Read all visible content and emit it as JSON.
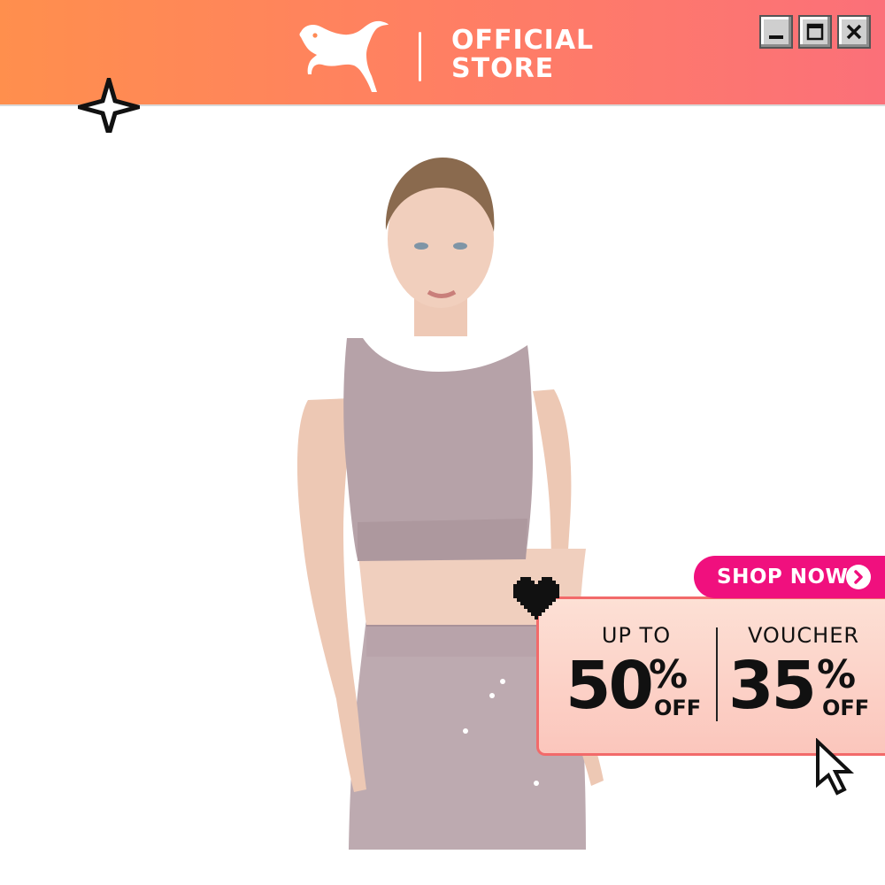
{
  "header": {
    "logo_icon": "puma-cat-logo",
    "store_line1": "OFFICIAL",
    "store_line2": "STORE",
    "colors": {
      "gradient_start": "#ff8f4d",
      "gradient_end": "#fb7079"
    }
  },
  "window_controls": {
    "minimize_icon": "minimize-icon",
    "maximize_icon": "maximize-icon",
    "close_icon": "close-icon"
  },
  "decorations": {
    "sparkle_icon": "sparkle-icon",
    "heart_icon": "pixel-heart-icon",
    "cursor_icon": "pointer-cursor-icon"
  },
  "promo": {
    "cta_label": "SHOP NOW",
    "cta_icon": "chevron-right-circle-icon",
    "left": {
      "top_text": "UP TO",
      "value": "50",
      "percent": "%",
      "suffix": "OFF"
    },
    "right": {
      "top_text": "VOUCHER",
      "value": "35",
      "percent": "%",
      "suffix": "OFF"
    },
    "colors": {
      "cta": "#f0107e",
      "card_border": "#f26a6a",
      "card_bg": "#fbc6bc"
    }
  }
}
